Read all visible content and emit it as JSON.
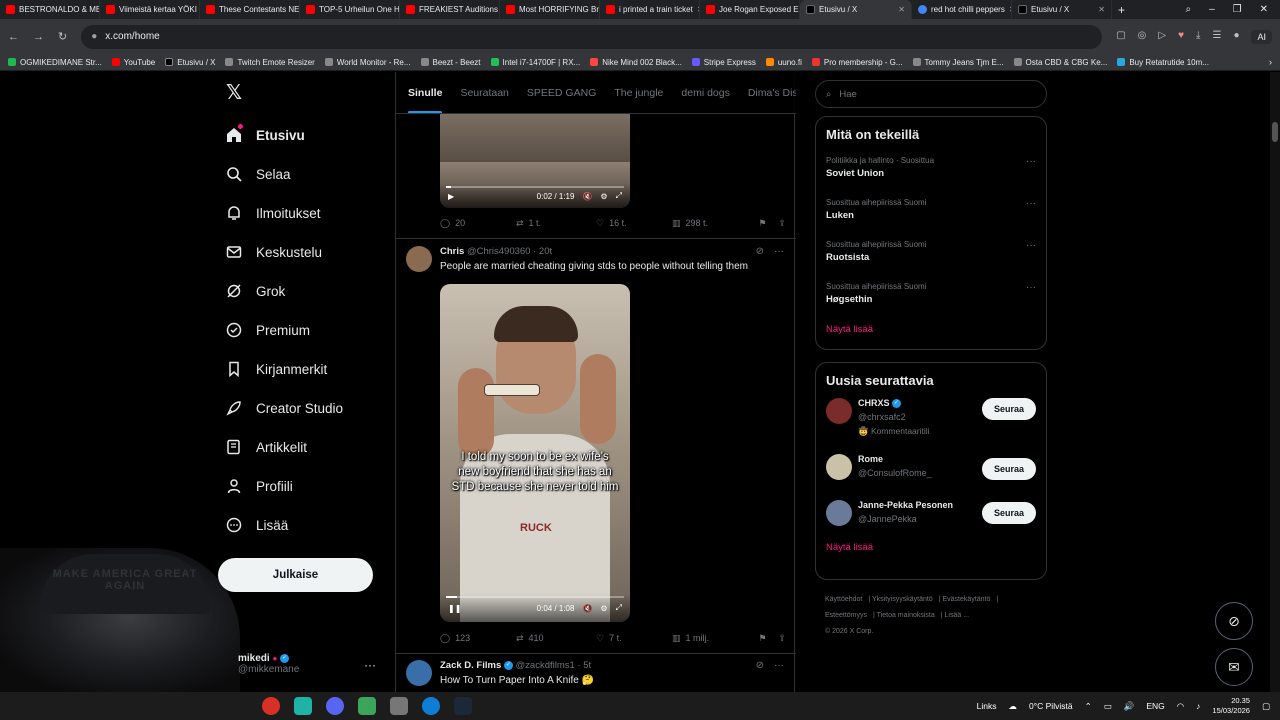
{
  "browser": {
    "tabs": [
      {
        "title": "BESTRONALDO & ME",
        "icon": "youtube"
      },
      {
        "title": "Viimeistä kertaa YÖKI",
        "icon": "youtube"
      },
      {
        "title": "These Contestants NE",
        "icon": "youtube"
      },
      {
        "title": "TOP-5 Urheilun One H",
        "icon": "youtube"
      },
      {
        "title": "FREAKIEST Auditions",
        "icon": "youtube"
      },
      {
        "title": "Most HORRIFYING Bri",
        "icon": "youtube"
      },
      {
        "title": "i printed a train ticket",
        "icon": "youtube"
      },
      {
        "title": "Joe Rogan Exposed Eli",
        "icon": "youtube"
      },
      {
        "title": "Etusivu / X",
        "icon": "x",
        "active": true
      },
      {
        "title": "red hot chilli peppers",
        "icon": "google"
      },
      {
        "title": "Etusivu / X",
        "icon": "x"
      }
    ],
    "url": "x.com/home",
    "ai_label": "AI",
    "bookmarks": [
      "OGMIKEDIMANE Str...",
      "YouTube",
      "Etusivu / X",
      "Twitch Emote Resizer",
      "World Monitor - Re...",
      "Beezt - Beezt",
      "Intel i7-14700F | RX...",
      "Nike Mind 002 Black...",
      "Stripe Express",
      "uuno.fi",
      "Pro membership - G...",
      "Tommy Jeans Tjm E...",
      "Osta CBD & CBG Ke...",
      "Buy Retatrutide 10m..."
    ]
  },
  "nav": {
    "items": [
      {
        "label": "Etusivu",
        "icon": "home-icon",
        "active": true
      },
      {
        "label": "Selaa",
        "icon": "search-icon"
      },
      {
        "label": "Ilmoitukset",
        "icon": "bell-icon"
      },
      {
        "label": "Keskustelu",
        "icon": "mail-icon"
      },
      {
        "label": "Grok",
        "icon": "grok-icon"
      },
      {
        "label": "Premium",
        "icon": "premium-icon"
      },
      {
        "label": "Kirjanmerkit",
        "icon": "bookmark-icon"
      },
      {
        "label": "Creator Studio",
        "icon": "rocket-icon"
      },
      {
        "label": "Artikkelit",
        "icon": "article-icon"
      },
      {
        "label": "Profiili",
        "icon": "person-icon"
      },
      {
        "label": "Lisää",
        "icon": "more-circle-icon"
      }
    ],
    "post_label": "Julkaise",
    "profile": {
      "name": "mikedi",
      "handle": "@mikkemane"
    }
  },
  "webcam": {
    "cap_text": "MAKE AMERICA GREAT AGAIN"
  },
  "timeline": {
    "tabs": [
      "Sinulle",
      "Seurataan",
      "SPEED GANG",
      "The jungle",
      "demi dogs",
      "Dima's Dist"
    ],
    "active_tab": "Sinulle",
    "top_video": {
      "time": "0:02 / 1:19",
      "progress": 0.03
    },
    "top_actions": {
      "replies": "20",
      "reposts": "1 t.",
      "likes": "16 t.",
      "views": "298 t."
    },
    "tweet1": {
      "name": "Chris",
      "handle": "@Chris490360",
      "age": "20t",
      "text": "People are married cheating giving stds to people without telling them",
      "caption": "I told my soon to be ex wife's new boyfriend that she has an STD because she never told him",
      "video_time": "0:04 / 1:08",
      "progress": 0.06,
      "shirt_text": "RUCK",
      "actions": {
        "replies": "123",
        "reposts": "410",
        "likes": "7 t.",
        "views": "1 milj."
      }
    },
    "tweet2": {
      "name": "Zack D. Films",
      "handle": "@zackdfilms1",
      "age": "5t",
      "text": "How To Turn Paper Into A Knife 🤔"
    }
  },
  "sidebar": {
    "search_placeholder": "Hae",
    "trends_title": "Mitä on tekeillä",
    "trends": [
      {
        "context": "Politiikka ja hallinto · Suosittua",
        "title": "Soviet Union"
      },
      {
        "context": "Suosittua aihepiirissä Suomi",
        "title": "Luken"
      },
      {
        "context": "Suosittua aihepiirissä Suomi",
        "title": "Ruotsista"
      },
      {
        "context": "Suosittua aihepiirissä Suomi",
        "title": "Høgsethin"
      }
    ],
    "show_more": "Näytä lisää",
    "follow_title": "Uusia seurattavia",
    "follow": [
      {
        "name": "CHRXS",
        "handle": "@chrxsafc2",
        "sub": "🤠 Kommentaaritili",
        "verified": true,
        "color": "#7a2b2b"
      },
      {
        "name": "Rome",
        "handle": "@ConsulofRome_",
        "sub": "",
        "verified": false,
        "color": "#c9c2a8"
      },
      {
        "name": "Janne-Pekka Pesonen",
        "handle": "@JannePekka",
        "sub": "",
        "verified": false,
        "color": "#6a7b9a"
      }
    ],
    "follow_btn": "Seuraa",
    "footer": [
      "Käyttöehdot",
      "Yksityisyyskäytäntö",
      "Evästekäytäntö",
      "Esteettömyys",
      "Tietoa mainoksista",
      "Lisää ...",
      "© 2026 X Corp."
    ]
  },
  "taskbar": {
    "links": "Links",
    "weather": "0°C Pilvistä",
    "lang": "ENG",
    "time": "20.35",
    "date": "15/03/2026"
  }
}
